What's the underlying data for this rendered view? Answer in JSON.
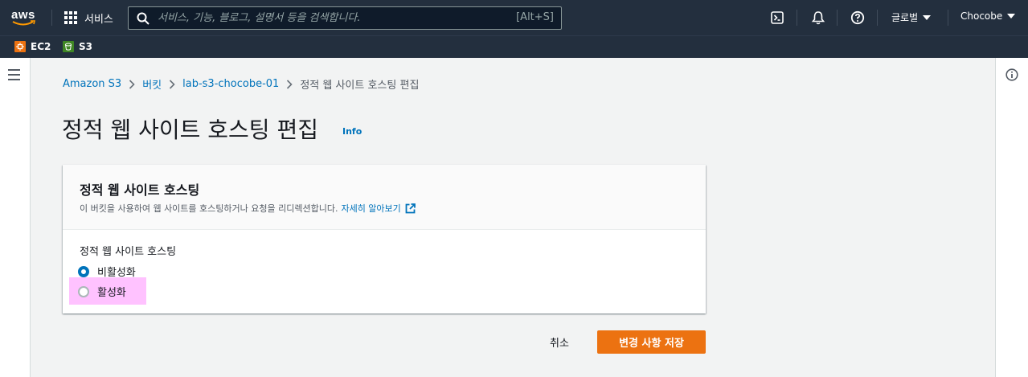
{
  "topnav": {
    "logo_text": "aws",
    "services_label": "서비스",
    "search_placeholder": "서비스, 기능, 블로그, 설명서 등을 검색합니다.",
    "search_shortcut": "[Alt+S]",
    "region_label": "글로벌",
    "account_label": "Chocobe"
  },
  "favorites": [
    {
      "label": "EC2",
      "icon": "ec2-icon",
      "color": "#ec7211"
    },
    {
      "label": "S3",
      "icon": "s3-icon",
      "color": "#3f8624"
    }
  ],
  "breadcrumb": {
    "items": [
      "Amazon S3",
      "버킷",
      "lab-s3-chocobe-01"
    ],
    "current": "정적 웹 사이트 호스팅 편집"
  },
  "page": {
    "title": "정적 웹 사이트 호스팅 편집",
    "info_link": "Info"
  },
  "panel": {
    "title": "정적 웹 사이트 호스팅",
    "description": "이 버킷을 사용하여 웹 사이트를 호스팅하거나 요청을 리디렉션합니다.",
    "learn_more": "자세히 알아보기",
    "field_label": "정적 웹 사이트 호스팅",
    "options": [
      {
        "label": "비활성화",
        "selected": true
      },
      {
        "label": "활성화",
        "selected": false
      }
    ]
  },
  "actions": {
    "cancel": "취소",
    "save": "변경 사항 저장"
  },
  "colors": {
    "nav_bg": "#232f3e",
    "link": "#0073bb",
    "primary_button": "#ec7211",
    "highlight": "#ffbfff"
  }
}
